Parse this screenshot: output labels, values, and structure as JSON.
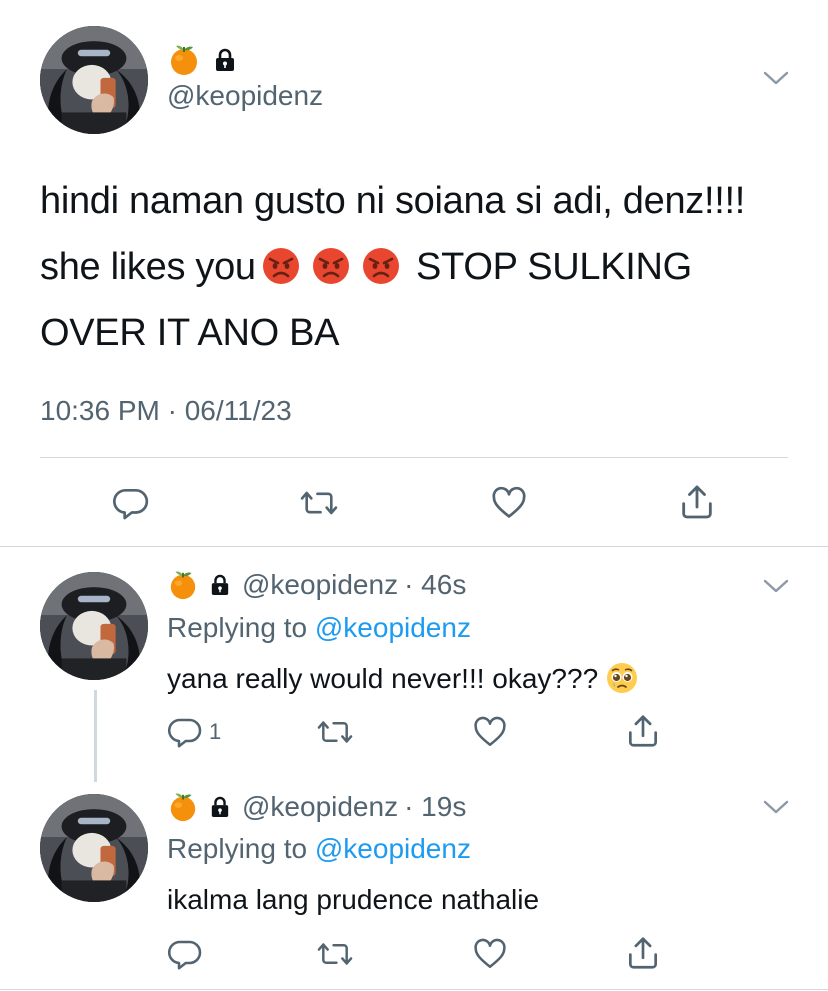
{
  "main_tweet": {
    "handle": "@keopidenz",
    "text_part1": "hindi naman gusto ni soiana si adi, denz!!!! she likes you",
    "text_part2": "STOP SULKING OVER IT ANO BA",
    "timestamp": "10:36 PM · 06/11/23",
    "icons": [
      "tangerine-emoji",
      "lock-icon",
      "chevron-down-icon",
      "angry-face-emoji"
    ]
  },
  "replies": [
    {
      "handle": "@keopidenz",
      "time": "· 46s",
      "replying_prefix": "Replying to",
      "replying_mention": "@keopidenz",
      "text": "yana really would never!!! okay???",
      "reply_count": "1"
    },
    {
      "handle": "@keopidenz",
      "time": "· 19s",
      "replying_prefix": "Replying to",
      "replying_mention": "@keopidenz",
      "text": "ikalma lang prudence nathalie",
      "reply_count": ""
    }
  ],
  "colors": {
    "text": "#0f1419",
    "secondary": "#536471",
    "accent": "#1d9bf0",
    "divider": "#cfd9de"
  }
}
